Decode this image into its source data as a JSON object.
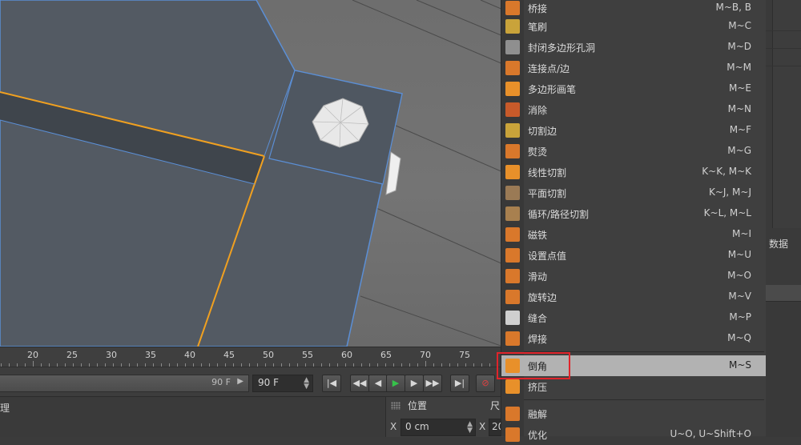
{
  "timeline": {
    "ticks": [
      "20",
      "25",
      "30",
      "35",
      "40",
      "45",
      "50",
      "55",
      "60",
      "65",
      "70",
      "75"
    ]
  },
  "transport": {
    "slider_value": "90 F",
    "slider_arrow": "▶",
    "frame_field_value": "90 F",
    "buttons": [
      {
        "name": "go-to-start-button",
        "glyph": "|◀"
      },
      {
        "name": "previous-key-button",
        "glyph": "◀◀"
      },
      {
        "name": "step-back-button",
        "glyph": "◀"
      },
      {
        "name": "play-button",
        "glyph": "▶"
      },
      {
        "name": "step-forward-button",
        "glyph": "▶"
      },
      {
        "name": "next-key-button",
        "glyph": "▶▶"
      },
      {
        "name": "go-to-end-button",
        "glyph": "▶|"
      },
      {
        "name": "record-button",
        "glyph": "⊘"
      }
    ]
  },
  "bottom": {
    "left_label": "理"
  },
  "coordinates": {
    "title": "位置",
    "title2": "尺",
    "axis_label": "X",
    "x_value": "0 cm",
    "axis_label_2": "X",
    "x_value_2": "20"
  },
  "menu": {
    "items": [
      {
        "label": "桥接",
        "shortcut": "M~B, B",
        "icon": "bridge-icon",
        "color": "#d9782b"
      },
      {
        "label": "笔刷",
        "shortcut": "M~C",
        "icon": "brush-icon",
        "color": "#c9a33a"
      },
      {
        "label": "封闭多边形孔洞",
        "shortcut": "M~D",
        "icon": "close-polygon-hole-icon",
        "color": "#8f8f8f"
      },
      {
        "label": "连接点/边",
        "shortcut": "M~M",
        "icon": "connect-points-edges-icon",
        "color": "#d9782b"
      },
      {
        "label": "多边形画笔",
        "shortcut": "M~E",
        "icon": "polygon-pen-icon",
        "color": "#e8902a"
      },
      {
        "label": "消除",
        "shortcut": "M~N",
        "icon": "dissolve-icon",
        "color": "#c85a2a"
      },
      {
        "label": "切割边",
        "shortcut": "M~F",
        "icon": "edge-cut-icon",
        "color": "#c9a33a"
      },
      {
        "label": "熨烫",
        "shortcut": "M~G",
        "icon": "iron-icon",
        "color": "#d9782b"
      },
      {
        "label": "线性切割",
        "shortcut": "K~K, M~K",
        "icon": "line-cut-icon",
        "color": "#e8902a"
      },
      {
        "label": "平面切割",
        "shortcut": "K~J, M~J",
        "icon": "plane-cut-icon",
        "color": "#9a7a55"
      },
      {
        "label": "循环/路径切割",
        "shortcut": "K~L, M~L",
        "icon": "loop-path-cut-icon",
        "color": "#a8804f"
      },
      {
        "label": "磁铁",
        "shortcut": "M~I",
        "icon": "magnet-icon",
        "color": "#d9782b"
      },
      {
        "label": "设置点值",
        "shortcut": "M~U",
        "icon": "set-point-value-icon",
        "color": "#d9782b"
      },
      {
        "label": "滑动",
        "shortcut": "M~O",
        "icon": "slide-icon",
        "color": "#d9782b"
      },
      {
        "label": "旋转边",
        "shortcut": "M~V",
        "icon": "spin-edge-icon",
        "color": "#d9782b"
      },
      {
        "label": "缝合",
        "shortcut": "M~P",
        "icon": "stitch-icon",
        "color": "#cfcfcf"
      },
      {
        "label": "焊接",
        "shortcut": "M~Q",
        "icon": "weld-icon",
        "color": "#d9782b"
      },
      {
        "label": "倒角",
        "shortcut": "M~S",
        "icon": "bevel-icon",
        "color": "#e8902a"
      },
      {
        "label": "挤压",
        "shortcut": "",
        "icon": "extrude-icon",
        "color": "#e8902a"
      },
      {
        "label": "融解",
        "shortcut": "",
        "icon": "melt-icon",
        "color": "#d9782b"
      },
      {
        "label": "优化",
        "shortcut": "U~O, U~Shift+O",
        "icon": "optimize-icon",
        "color": "#d9782b"
      }
    ],
    "highlighted_index": 17
  },
  "right_panel": {
    "tab_label": "数据"
  },
  "colors": {
    "selection_edge": "#f0a020",
    "mesh_border": "#5b8fd6",
    "menu_highlight": "#b2b2b2",
    "annotation_red": "#e0242b",
    "play_green": "#36c24a"
  }
}
